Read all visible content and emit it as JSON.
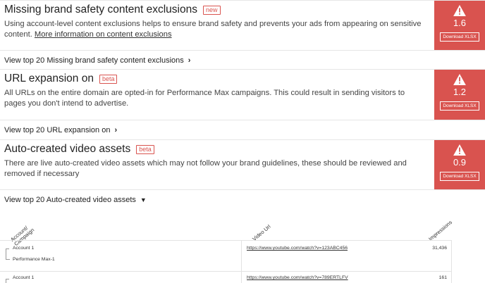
{
  "cards": [
    {
      "title": "Missing brand safety content exclusions",
      "badge": "new",
      "description": "Using account-level content exclusions helps to ensure brand safety and prevents your ads from appearing on sensitive content.",
      "link": "More information on content exclusions",
      "score": "1.6",
      "download": "Download XLSX",
      "view_top": "View top 20 Missing brand safety content exclusions"
    },
    {
      "title": "URL expansion on",
      "badge": "beta",
      "description": "All URLs on the entire domain are opted-in for Performance Max campaigns. This could result in sending visitors to pages you don't intend to advertise.",
      "score": "1.2",
      "download": "Download XLSX",
      "view_top": "View top 20 URL expansion on"
    },
    {
      "title": "Auto-created video assets",
      "badge": "beta",
      "description": "There are live auto-created video assets which may not follow your brand guidelines, these should be reviewed and removed if necessary",
      "score": "0.9",
      "download": "Download XLSX",
      "view_top": "View top 20 Auto-created video assets"
    }
  ],
  "table": {
    "headers": [
      "Account/ Campaign",
      "Video Url",
      "Impressions"
    ],
    "rows": [
      {
        "account": "Account 1",
        "campaign": "Performance Max-1",
        "url": "https://www.youtube.com/watch?v=123ABC456",
        "impressions": "31,436"
      },
      {
        "account": "Account 1",
        "url": "https://www.youtube.com/watch?v=789ERTLFV",
        "impressions": "161"
      }
    ]
  },
  "icons": {
    "warning": "warning-triangle-icon",
    "chevron_right": "chevron-right-icon",
    "chevron_down": "chevron-down-icon"
  },
  "colors": {
    "accent": "#d9534f"
  }
}
